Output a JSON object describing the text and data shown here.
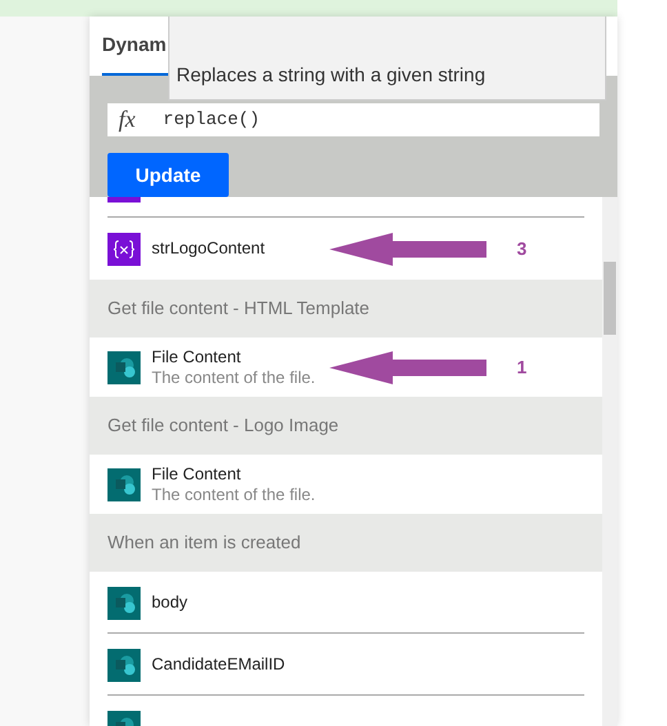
{
  "tab": {
    "label": "Dynam",
    "selected": true
  },
  "tooltip": {
    "text": "Replaces a string with a given string"
  },
  "expression": {
    "value": "replace()",
    "icon": "fx"
  },
  "update_button": "Update",
  "list": [
    {
      "kind": "variable",
      "title": "strLogoContent",
      "annotation": "3"
    },
    {
      "kind": "header",
      "title": "Get file content - HTML Template"
    },
    {
      "kind": "file",
      "title": "File Content",
      "description": "The content of the file.",
      "annotation": "1"
    },
    {
      "kind": "header",
      "title": "Get file content - Logo Image"
    },
    {
      "kind": "file",
      "title": "File Content",
      "description": "The content of the file."
    },
    {
      "kind": "header",
      "title": "When an item is created"
    },
    {
      "kind": "file",
      "title": "body"
    },
    {
      "kind": "file",
      "title": "CandidateEMailID"
    },
    {
      "kind": "file"
    }
  ]
}
